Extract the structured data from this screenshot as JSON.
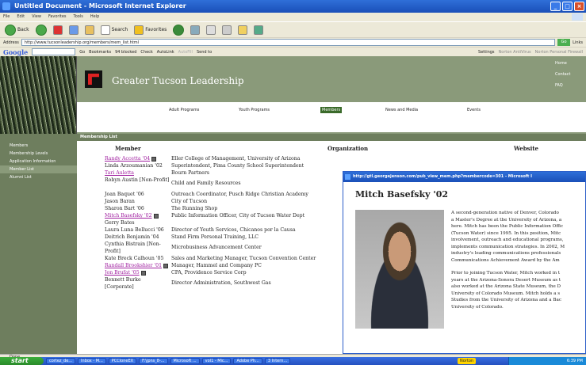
{
  "window": {
    "title": "Untitled Document - Microsoft Internet Explorer"
  },
  "menu": [
    "File",
    "Edit",
    "View",
    "Favorites",
    "Tools",
    "Help"
  ],
  "toolbar": {
    "back": "Back",
    "search": "Search",
    "favorites": "Favorites"
  },
  "address": {
    "label": "Address",
    "url": "http://www.tucsonleadership.org/members/mem_list.html",
    "go": "Go",
    "links": "Links"
  },
  "googlebar": {
    "logo": "Google",
    "go": "Go",
    "bookmarks": "Bookmarks",
    "blocked": "94 blocked",
    "check": "Check",
    "autolink": "AutoLink",
    "autofill": "AutoFill",
    "send": "Send to",
    "settings": "Settings",
    "norton_antivirus": "Norton AntiVirus",
    "norton_pf": "Norton Personal Firewall"
  },
  "site": {
    "name": "Greater Tucson Leadership",
    "toplinks": [
      "Home",
      "Contact",
      "FAQ"
    ]
  },
  "nav": [
    "Adult Programs",
    "Youth Programs",
    "Members",
    "News and Media",
    "Events"
  ],
  "sidebar": [
    "Members",
    "Membership Levels",
    "Application Information",
    "Member List",
    "Alumni List"
  ],
  "list_title": "Membership List",
  "columns": {
    "member": "Member",
    "organization": "Organization",
    "website": "Website"
  },
  "members": [
    {
      "name": "Randy Accetta '04",
      "org": "Eller College of Management, University of Arizona",
      "link": true,
      "pdf": true
    },
    {
      "name": "Linda Arzoumanian '02",
      "org": "Superintendent, Pima County School Superintendent",
      "link": false
    },
    {
      "name": "Tari Auletta",
      "org": "Bourn Partners",
      "link": true
    },
    {
      "name": "Robyn Austin [Non-Profit]",
      "org": "Child and Family Resources",
      "link": false,
      "tall": true
    },
    {
      "name": "Joan Baquet '06",
      "org": "Outreach Coordinator, Pusch Ridge Christian Academy",
      "link": false
    },
    {
      "name": "Jason Baran",
      "org": "City of Tucson",
      "link": false
    },
    {
      "name": "Sharon Bart '06",
      "org": "The Running Shop",
      "link": false
    },
    {
      "name": "Mitch Basefsky '02",
      "org": "Public Information Officer, City of Tucson Water Dept",
      "link": true,
      "pdf": true
    },
    {
      "name": "Gerry Bates",
      "org": "",
      "link": false
    },
    {
      "name": "Laura Luna Bellucci '06",
      "org": "Director of Youth Services, Chicanos por la Causa",
      "link": false
    },
    {
      "name": "Deitrich Benjamin '04",
      "org": "Stand Firm Personal Training, LLC",
      "link": false
    },
    {
      "name": "Cynthia Bistrain [Non-Profit]",
      "org": "Microbusiness Advancement Center",
      "link": false,
      "tall": true
    },
    {
      "name": "Kate Breck Calhoun '05",
      "org": "Sales and Marketing Manager, Tucson Convention Center",
      "link": false
    },
    {
      "name": "Randall Brookshier '01",
      "org": "Manager, Hammel and Company PC",
      "link": true,
      "pdf": true
    },
    {
      "name": "Jon Brufat '05",
      "org": "CPA, Providence Service Corp",
      "link": true,
      "pdf": true
    },
    {
      "name": "Bennett Burke [Corporate]",
      "org": "Director Administration, Southwest Gas",
      "link": false,
      "tall": true
    }
  ],
  "popup": {
    "url": "http://gtl.georgejenson.com/pub_view_mem.php?membercode=301 - Microsoft I",
    "heading": "Mitch Basefsky '02",
    "bio1": [
      "A second-generation native of Denver, Colorado",
      "a Master's Degree at the University of Arizona, a",
      "here. Mitch has been the Public Information Offic",
      "(Tucson Water) since 1995. In this position, Mitc",
      "involvement, outreach and educational programs,",
      "implements communication strategies. In 2002, M",
      "industry's leading communications professionals",
      "Communications Achievement Award by the Am"
    ],
    "bio2": [
      "Prior to joining Tucson Water, Mitch worked in t",
      "years at the Arizona-Sonora Desert Museum as t",
      "also worked at the Arizona State Museum, the D",
      "University of Colorado Museum. Mitch holds a s",
      "Studies from the University of Arizona and a Bac",
      "University of Colorado."
    ]
  },
  "status": "Done",
  "taskbar": {
    "start": "start",
    "tasks": [
      "cortez_de...",
      "Inbox - M...",
      "PCCloneEX",
      "F:\\jpns_8-...",
      "Microsoft ...",
      "vol1 - Mic...",
      "Adobe Ph...",
      "3 Intern..."
    ],
    "norton": "Norton",
    "clock": "6:39 PM"
  }
}
